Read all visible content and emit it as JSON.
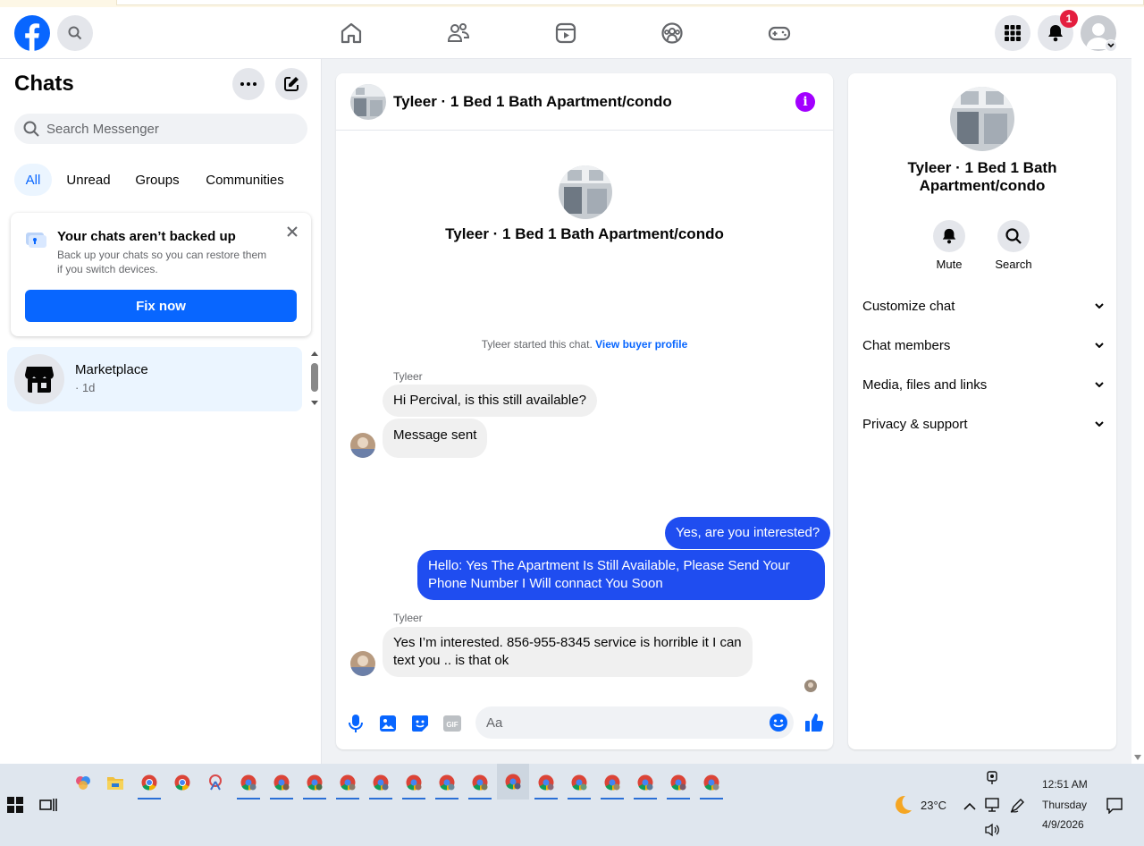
{
  "header": {
    "notification_count": "1"
  },
  "left": {
    "title": "Chats",
    "search_placeholder": "Search Messenger",
    "filters": [
      "All",
      "Unread",
      "Groups",
      "Communities"
    ],
    "backup": {
      "title": "Your chats aren’t backed up",
      "desc": "Back up your chats so you can restore them if you switch devices.",
      "button": "Fix now"
    },
    "chat_item": {
      "name": "Marketplace",
      "time": "· 1d"
    }
  },
  "conversation": {
    "title": "Tyleer · 1 Bed 1 Bath Apartment/condo",
    "intro_title": "Tyleer · 1 Bed 1 Bath Apartment/condo",
    "started_text": "Tyleer started this chat.",
    "started_link": "View buyer profile",
    "messages": [
      {
        "sender": "Tyleer",
        "text": "Hi Percival, is this still available?"
      },
      {
        "text": "Message sent"
      },
      {
        "text": "Yes, are you interested?"
      },
      {
        "text": "Hello: Yes The Apartment Is Still Available, Please Send Your Phone Number I Will connact You Soon"
      },
      {
        "sender": "Tyleer",
        "text": "Yes I’m interested. 856-955-8345 service is horrible it I can text you .. is that ok"
      }
    ],
    "composer_placeholder": "Aa"
  },
  "details": {
    "title": "Tyleer · 1 Bed 1 Bath Apartment/condo",
    "actions": [
      "Mute",
      "Search"
    ],
    "sections": [
      "Customize chat",
      "Chat members",
      "Media, files and links",
      "Privacy & support"
    ]
  },
  "taskbar": {
    "weather": "23°C",
    "time": "12:51 AM",
    "day": "Thursday",
    "date": "4/9/2026"
  },
  "colors": {
    "brand": "#0866ff",
    "out_bubble": "#1f4df0",
    "info": "#a200ff",
    "badge": "#e41e3f"
  }
}
